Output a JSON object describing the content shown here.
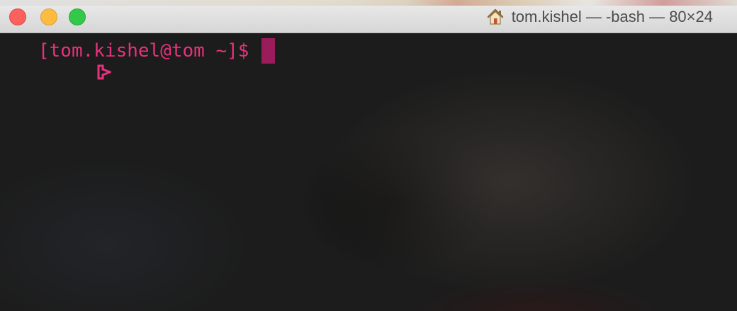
{
  "window": {
    "title": "tom.kishel — -bash — 80×24",
    "title_icon": "home-icon"
  },
  "terminal": {
    "prompt": "[tom.kishel@tom ~]$",
    "prompt_glyph_icon": "git-branch-icon",
    "prompt_color": "#e8317d",
    "cursor_color": "#9b1c5a",
    "background_color": "#1c1c1c"
  }
}
